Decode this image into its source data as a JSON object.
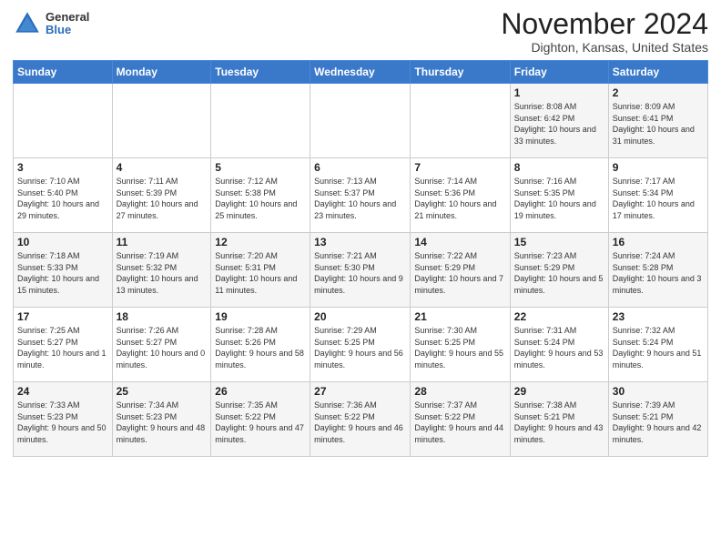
{
  "header": {
    "logo": {
      "general": "General",
      "blue": "Blue"
    },
    "title": "November 2024",
    "location": "Dighton, Kansas, United States"
  },
  "weekdays": [
    "Sunday",
    "Monday",
    "Tuesday",
    "Wednesday",
    "Thursday",
    "Friday",
    "Saturday"
  ],
  "weeks": [
    [
      {
        "day": "",
        "info": ""
      },
      {
        "day": "",
        "info": ""
      },
      {
        "day": "",
        "info": ""
      },
      {
        "day": "",
        "info": ""
      },
      {
        "day": "",
        "info": ""
      },
      {
        "day": "1",
        "info": "Sunrise: 8:08 AM\nSunset: 6:42 PM\nDaylight: 10 hours and 33 minutes."
      },
      {
        "day": "2",
        "info": "Sunrise: 8:09 AM\nSunset: 6:41 PM\nDaylight: 10 hours and 31 minutes."
      }
    ],
    [
      {
        "day": "3",
        "info": "Sunrise: 7:10 AM\nSunset: 5:40 PM\nDaylight: 10 hours and 29 minutes."
      },
      {
        "day": "4",
        "info": "Sunrise: 7:11 AM\nSunset: 5:39 PM\nDaylight: 10 hours and 27 minutes."
      },
      {
        "day": "5",
        "info": "Sunrise: 7:12 AM\nSunset: 5:38 PM\nDaylight: 10 hours and 25 minutes."
      },
      {
        "day": "6",
        "info": "Sunrise: 7:13 AM\nSunset: 5:37 PM\nDaylight: 10 hours and 23 minutes."
      },
      {
        "day": "7",
        "info": "Sunrise: 7:14 AM\nSunset: 5:36 PM\nDaylight: 10 hours and 21 minutes."
      },
      {
        "day": "8",
        "info": "Sunrise: 7:16 AM\nSunset: 5:35 PM\nDaylight: 10 hours and 19 minutes."
      },
      {
        "day": "9",
        "info": "Sunrise: 7:17 AM\nSunset: 5:34 PM\nDaylight: 10 hours and 17 minutes."
      }
    ],
    [
      {
        "day": "10",
        "info": "Sunrise: 7:18 AM\nSunset: 5:33 PM\nDaylight: 10 hours and 15 minutes."
      },
      {
        "day": "11",
        "info": "Sunrise: 7:19 AM\nSunset: 5:32 PM\nDaylight: 10 hours and 13 minutes."
      },
      {
        "day": "12",
        "info": "Sunrise: 7:20 AM\nSunset: 5:31 PM\nDaylight: 10 hours and 11 minutes."
      },
      {
        "day": "13",
        "info": "Sunrise: 7:21 AM\nSunset: 5:30 PM\nDaylight: 10 hours and 9 minutes."
      },
      {
        "day": "14",
        "info": "Sunrise: 7:22 AM\nSunset: 5:29 PM\nDaylight: 10 hours and 7 minutes."
      },
      {
        "day": "15",
        "info": "Sunrise: 7:23 AM\nSunset: 5:29 PM\nDaylight: 10 hours and 5 minutes."
      },
      {
        "day": "16",
        "info": "Sunrise: 7:24 AM\nSunset: 5:28 PM\nDaylight: 10 hours and 3 minutes."
      }
    ],
    [
      {
        "day": "17",
        "info": "Sunrise: 7:25 AM\nSunset: 5:27 PM\nDaylight: 10 hours and 1 minute."
      },
      {
        "day": "18",
        "info": "Sunrise: 7:26 AM\nSunset: 5:27 PM\nDaylight: 10 hours and 0 minutes."
      },
      {
        "day": "19",
        "info": "Sunrise: 7:28 AM\nSunset: 5:26 PM\nDaylight: 9 hours and 58 minutes."
      },
      {
        "day": "20",
        "info": "Sunrise: 7:29 AM\nSunset: 5:25 PM\nDaylight: 9 hours and 56 minutes."
      },
      {
        "day": "21",
        "info": "Sunrise: 7:30 AM\nSunset: 5:25 PM\nDaylight: 9 hours and 55 minutes."
      },
      {
        "day": "22",
        "info": "Sunrise: 7:31 AM\nSunset: 5:24 PM\nDaylight: 9 hours and 53 minutes."
      },
      {
        "day": "23",
        "info": "Sunrise: 7:32 AM\nSunset: 5:24 PM\nDaylight: 9 hours and 51 minutes."
      }
    ],
    [
      {
        "day": "24",
        "info": "Sunrise: 7:33 AM\nSunset: 5:23 PM\nDaylight: 9 hours and 50 minutes."
      },
      {
        "day": "25",
        "info": "Sunrise: 7:34 AM\nSunset: 5:23 PM\nDaylight: 9 hours and 48 minutes."
      },
      {
        "day": "26",
        "info": "Sunrise: 7:35 AM\nSunset: 5:22 PM\nDaylight: 9 hours and 47 minutes."
      },
      {
        "day": "27",
        "info": "Sunrise: 7:36 AM\nSunset: 5:22 PM\nDaylight: 9 hours and 46 minutes."
      },
      {
        "day": "28",
        "info": "Sunrise: 7:37 AM\nSunset: 5:22 PM\nDaylight: 9 hours and 44 minutes."
      },
      {
        "day": "29",
        "info": "Sunrise: 7:38 AM\nSunset: 5:21 PM\nDaylight: 9 hours and 43 minutes."
      },
      {
        "day": "30",
        "info": "Sunrise: 7:39 AM\nSunset: 5:21 PM\nDaylight: 9 hours and 42 minutes."
      }
    ]
  ]
}
